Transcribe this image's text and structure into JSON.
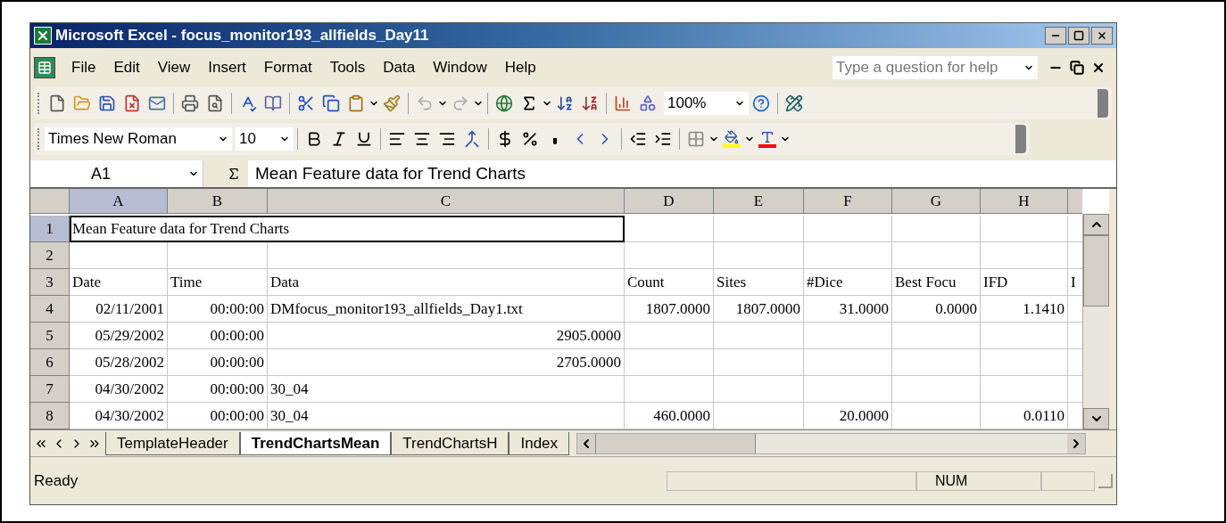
{
  "window": {
    "title": "Microsoft Excel - focus_monitor193_allfields_Day11"
  },
  "menu": [
    {
      "label": "File"
    },
    {
      "label": "Edit"
    },
    {
      "label": "View"
    },
    {
      "label": "Insert"
    },
    {
      "label": "Format"
    },
    {
      "label": "Tools"
    },
    {
      "label": "Data"
    },
    {
      "label": "Window"
    },
    {
      "label": "Help"
    }
  ],
  "help_box": {
    "placeholder": "Type a question for help"
  },
  "standard_toolbar": {
    "zoom": "100%"
  },
  "formatting_toolbar": {
    "font": "Times New Roman",
    "size": "10"
  },
  "formula_bar": {
    "name_box": "A1",
    "formula": "Mean Feature data for Trend Charts"
  },
  "columns": [
    {
      "label": "A",
      "selected": true
    },
    {
      "label": "B",
      "selected": false
    },
    {
      "label": "C",
      "selected": false
    },
    {
      "label": "D",
      "selected": false
    },
    {
      "label": "E",
      "selected": false
    },
    {
      "label": "F",
      "selected": false
    },
    {
      "label": "G",
      "selected": false
    },
    {
      "label": "H",
      "selected": false
    }
  ],
  "rows": [
    {
      "label": "1",
      "selected": true,
      "cells": [
        {
          "text": "Mean Feature data for Trend Charts",
          "kind": "text",
          "active": true
        },
        null,
        null,
        null,
        null,
        null,
        null,
        null,
        null
      ]
    },
    {
      "label": "2",
      "selected": false,
      "cells": [
        null,
        null,
        null,
        null,
        null,
        null,
        null,
        null,
        null
      ]
    },
    {
      "label": "3",
      "selected": false,
      "cells": [
        {
          "text": "Date",
          "kind": "text"
        },
        {
          "text": "Time",
          "kind": "text"
        },
        {
          "text": "Data",
          "kind": "text"
        },
        {
          "text": "Count",
          "kind": "text"
        },
        {
          "text": "Sites",
          "kind": "text"
        },
        {
          "text": "#Dice",
          "kind": "text"
        },
        {
          "text": "Best Focu",
          "kind": "text"
        },
        {
          "text": "IFD",
          "kind": "text"
        },
        {
          "text": "I",
          "kind": "text"
        }
      ]
    },
    {
      "label": "4",
      "selected": false,
      "cells": [
        {
          "text": "02/11/2001",
          "kind": "number"
        },
        {
          "text": "00:00:00",
          "kind": "number"
        },
        {
          "text": "DMfocus_monitor193_allfields_Day1.txt",
          "kind": "text"
        },
        {
          "text": "1807.0000",
          "kind": "number"
        },
        {
          "text": "1807.0000",
          "kind": "number"
        },
        {
          "text": "31.0000",
          "kind": "number"
        },
        {
          "text": "0.0000",
          "kind": "number"
        },
        {
          "text": "1.1410",
          "kind": "number"
        },
        null
      ]
    },
    {
      "label": "5",
      "selected": false,
      "cells": [
        {
          "text": "05/29/2002",
          "kind": "number"
        },
        {
          "text": "00:00:00",
          "kind": "number"
        },
        {
          "text": "2905.0000",
          "kind": "number"
        },
        null,
        null,
        null,
        null,
        null,
        null
      ]
    },
    {
      "label": "6",
      "selected": false,
      "cells": [
        {
          "text": "05/28/2002",
          "kind": "number"
        },
        {
          "text": "00:00:00",
          "kind": "number"
        },
        {
          "text": "2705.0000",
          "kind": "number"
        },
        null,
        null,
        null,
        null,
        null,
        null
      ]
    },
    {
      "label": "7",
      "selected": false,
      "cells": [
        {
          "text": "04/30/2002",
          "kind": "number"
        },
        {
          "text": "00:00:00",
          "kind": "number"
        },
        {
          "text": "30_04",
          "kind": "text"
        },
        null,
        null,
        null,
        null,
        null,
        null
      ]
    },
    {
      "label": "8",
      "selected": false,
      "cells": [
        {
          "text": "04/30/2002",
          "kind": "number"
        },
        {
          "text": "00:00:00",
          "kind": "number"
        },
        {
          "text": "30_04",
          "kind": "text"
        },
        {
          "text": "460.0000",
          "kind": "number"
        },
        null,
        {
          "text": "20.0000",
          "kind": "number"
        },
        null,
        {
          "text": "0.0110",
          "kind": "number"
        },
        null
      ]
    }
  ],
  "sheet_tabs": [
    {
      "label": "TemplateHeader",
      "selected": false
    },
    {
      "label": "TrendChartsMean",
      "selected": true
    },
    {
      "label": "TrendChartsH",
      "selected": false
    },
    {
      "label": "Index",
      "selected": false
    }
  ],
  "status_bar": {
    "status": "Ready",
    "num_lock": "NUM"
  }
}
